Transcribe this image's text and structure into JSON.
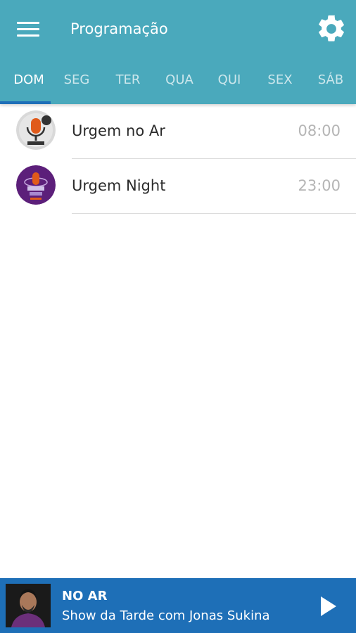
{
  "app": {
    "title": "Programação"
  },
  "tabs": [
    {
      "label": "DOM",
      "active": true
    },
    {
      "label": "SEG"
    },
    {
      "label": "TER"
    },
    {
      "label": "QUA"
    },
    {
      "label": "QUI"
    },
    {
      "label": "SEX"
    },
    {
      "label": "SÁB"
    }
  ],
  "programs": [
    {
      "name": "Urgem no Ar",
      "time": "08:00",
      "avatar_icon": "microphone-logo"
    },
    {
      "name": "Urgem Night",
      "time": "23:00",
      "avatar_icon": "microphone-logo-purple"
    }
  ],
  "player": {
    "status_label": "NO AR",
    "show_title": "Show da Tarde com Jonas Sukina",
    "play_icon": "play-icon"
  },
  "colors": {
    "appbar": "#4aa9bc",
    "tab_indicator": "#1f6fb8",
    "player_bg": "#1e6fb7",
    "time_text": "#b5b5b5"
  }
}
